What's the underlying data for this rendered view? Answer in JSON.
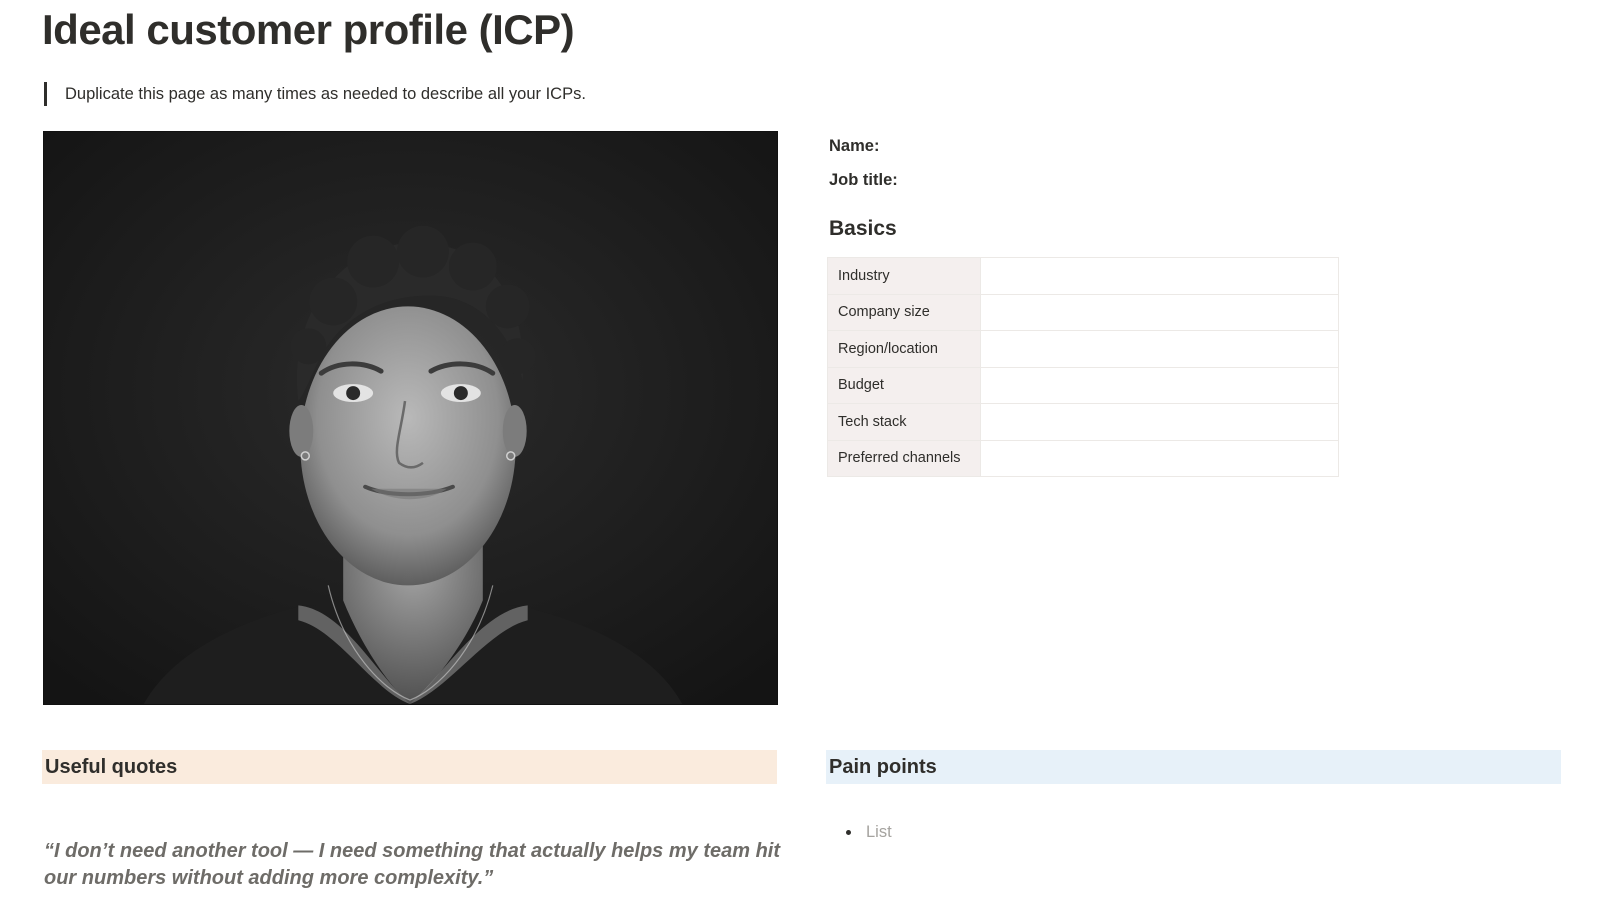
{
  "page": {
    "title": "Ideal customer profile (ICP)",
    "callout_text": "Duplicate this page as many times as needed to describe all your ICPs."
  },
  "profile": {
    "name_label": "Name:",
    "name_value": "",
    "job_title_label": "Job title:",
    "job_title_value": "",
    "photo_icon": "portrait-photo"
  },
  "basics": {
    "heading": "Basics",
    "rows": [
      {
        "key": "Industry",
        "value": ""
      },
      {
        "key": "Company size",
        "value": ""
      },
      {
        "key": "Region/location",
        "value": ""
      },
      {
        "key": "Budget",
        "value": ""
      },
      {
        "key": "Tech stack",
        "value": ""
      },
      {
        "key": "Preferred channels",
        "value": ""
      }
    ]
  },
  "useful_quotes": {
    "heading": "Useful quotes",
    "quote": "“I don’t need another tool — I need something that actually helps my team hit our numbers without adding more complexity.”"
  },
  "pain_points": {
    "heading": "Pain points",
    "items": [
      "List"
    ]
  },
  "colors": {
    "quotes_band": "#faebdd",
    "pain_band": "#e7f1f9",
    "table_key_bg": "#f4efee"
  }
}
